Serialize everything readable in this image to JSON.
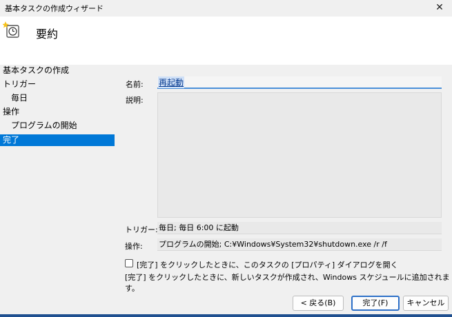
{
  "window": {
    "title": "基本タスクの作成ウィザード",
    "close_symbol": "✕"
  },
  "header": {
    "title": "要約",
    "icon": "task-scheduler-clock-icon"
  },
  "sidebar": {
    "items": [
      {
        "label": "基本タスクの作成",
        "selected": false
      },
      {
        "label": "トリガー",
        "selected": false
      },
      {
        "label": "毎日",
        "selected": false
      },
      {
        "label": "操作",
        "selected": false
      },
      {
        "label": "プログラムの開始",
        "selected": false
      },
      {
        "label": "完了",
        "selected": true
      }
    ]
  },
  "summary": {
    "name_label": "名前:",
    "name_value": "再起動",
    "description_label": "説明:",
    "description_value": "",
    "trigger_label": "トリガー:",
    "trigger_value": "毎日; 毎日 6:00 に起動",
    "action_label": "操作:",
    "action_value": "プログラムの開始; C:¥Windows¥System32¥shutdown.exe /r /f"
  },
  "options": {
    "open_properties_label": "[完了] をクリックしたときに、このタスクの [プロパティ] ダイアログを開く",
    "open_properties_checked": false,
    "info_text": "[完了] をクリックしたときに、新しいタスクが作成され、Windows スケジュールに追加されます。"
  },
  "buttons": {
    "back": "< 戻る(B)",
    "finish": "完了(F)",
    "cancel": "キャンセル"
  },
  "colors": {
    "selection": "#0078d7",
    "accent_border": "#2c6fc7"
  }
}
